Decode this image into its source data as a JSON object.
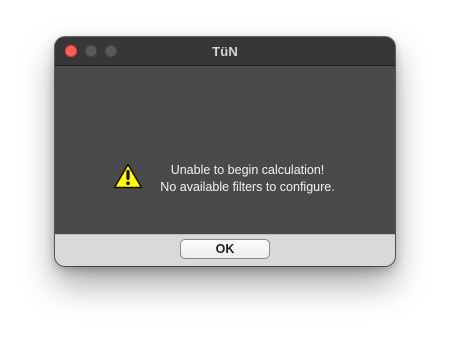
{
  "window": {
    "title": "TüN"
  },
  "dialog": {
    "icon": "warning-icon",
    "message_lines": [
      "Unable to begin calculation!",
      "No available filters to configure."
    ],
    "ok_label": "OK"
  },
  "colors": {
    "close_button": "#ff5f57",
    "warning_fill": "#ffff00",
    "content_bg": "#4b4949",
    "button_bar_bg": "#d9d9d9"
  }
}
